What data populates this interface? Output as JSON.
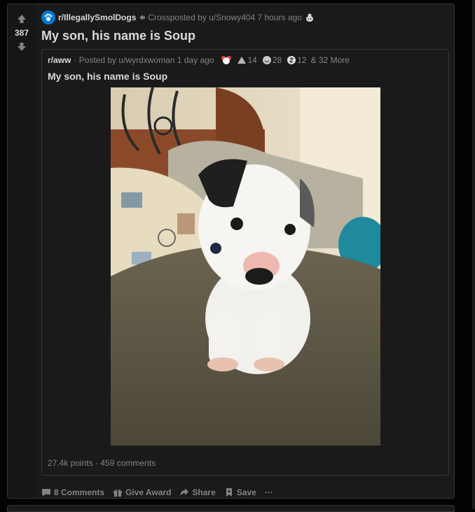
{
  "post": {
    "score": "387",
    "subreddit": "r/IllegallySmolDogs",
    "crosspost_text": "Crossposted by u/Snowy404 7 hours ago",
    "title": "My son, his name is Soup"
  },
  "original": {
    "subreddit": "r/aww",
    "posted_by": "· Posted by u/wyrdxwoman 1 day ago",
    "awards": [
      {
        "count": "14",
        "color": "#b8b8b8",
        "icon": "helpful-award-icon"
      },
      {
        "count": "28",
        "color": "#c8c8c8",
        "icon": "wholesome-award-icon"
      },
      {
        "count": "12",
        "color": "#e0e0e0",
        "icon": "silver-award-icon"
      }
    ],
    "more": "& 32 More",
    "title": "My son, his name is Soup",
    "stats": "27.4k points · 459 comments"
  },
  "actions": {
    "comments": "8 Comments",
    "give_award": "Give Award",
    "share": "Share",
    "save": "Save",
    "more": "···"
  }
}
